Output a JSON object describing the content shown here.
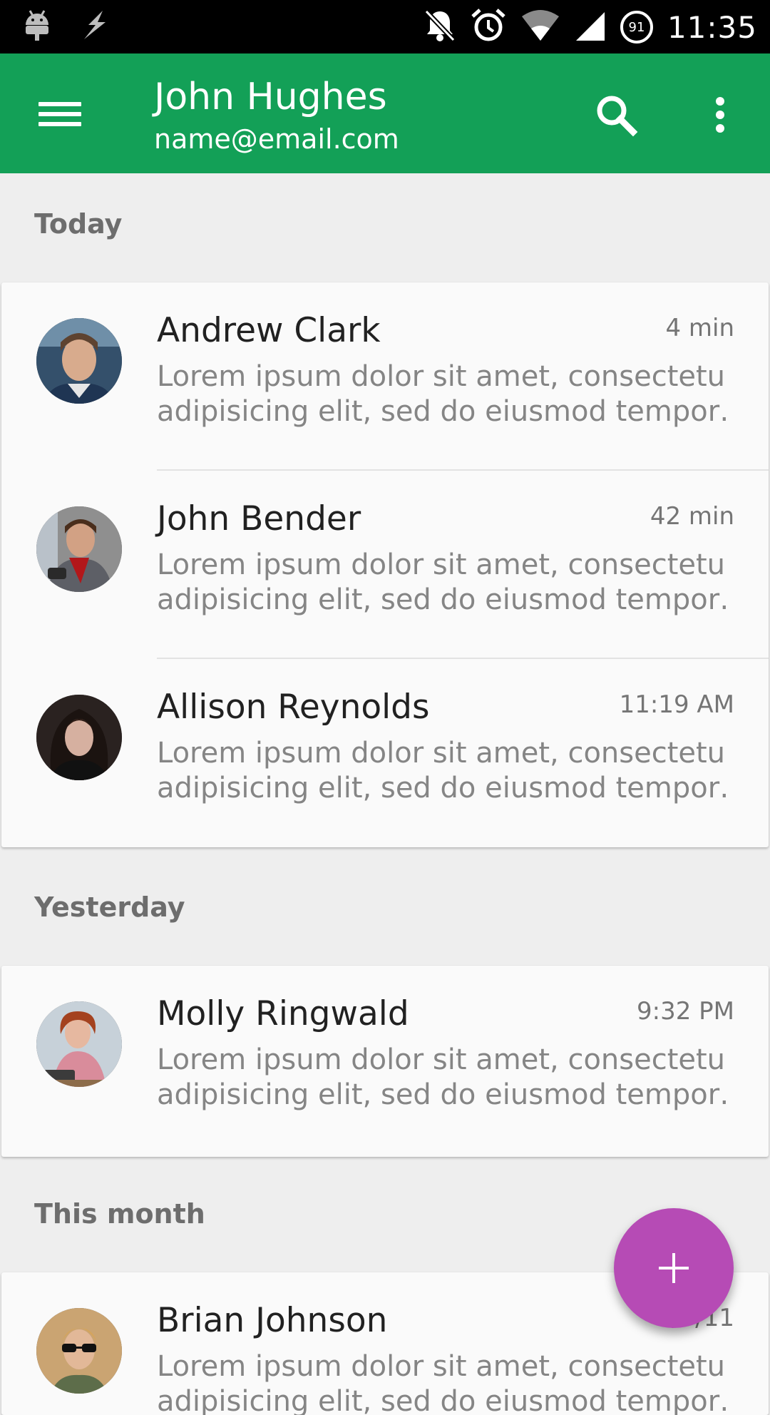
{
  "status_bar": {
    "time": "11:35",
    "battery_level": "91",
    "icons": [
      "android-icon",
      "bolt-icon",
      "notifications-off-icon",
      "alarm-icon",
      "wifi-icon",
      "signal-icon",
      "battery-icon"
    ]
  },
  "app_bar": {
    "title": "John Hughes",
    "subtitle": "name@email.com",
    "background": "#13a057",
    "icons": [
      "menu-icon",
      "search-icon",
      "more-vert-icon"
    ]
  },
  "sections": [
    {
      "title": "Today",
      "items": [
        {
          "name": "Andrew Clark",
          "time": "4 min",
          "snippet_line1": "Lorem ipsum dolor sit amet, consectetur",
          "snippet_line2": "adipisicing elit, sed do eiusmod tempor…"
        },
        {
          "name": "John Bender",
          "time": "42 min",
          "snippet_line1": "Lorem ipsum dolor sit amet, consectetur",
          "snippet_line2": "adipisicing elit, sed do eiusmod tempor…"
        },
        {
          "name": "Allison Reynolds",
          "time": "11:19 AM",
          "snippet_line1": "Lorem ipsum dolor sit amet, consectetur",
          "snippet_line2": "adipisicing elit, sed do eiusmod tempor…"
        }
      ]
    },
    {
      "title": "Yesterday",
      "items": [
        {
          "name": "Molly Ringwald",
          "time": "9:32 PM",
          "snippet_line1": "Lorem ipsum dolor sit amet, consectetur",
          "snippet_line2": "adipisicing elit, sed do eiusmod tempor…"
        }
      ]
    },
    {
      "title": "This month",
      "items": [
        {
          "name": "Brian Johnson",
          "time": "1/5/11",
          "snippet_line1": "Lorem ipsum dolor sit amet, consectetur",
          "snippet_line2": "adipisicing elit, sed do eiusmod tempor…"
        }
      ]
    }
  ],
  "fab": {
    "icon": "add-icon",
    "color": "#b64bb5"
  }
}
